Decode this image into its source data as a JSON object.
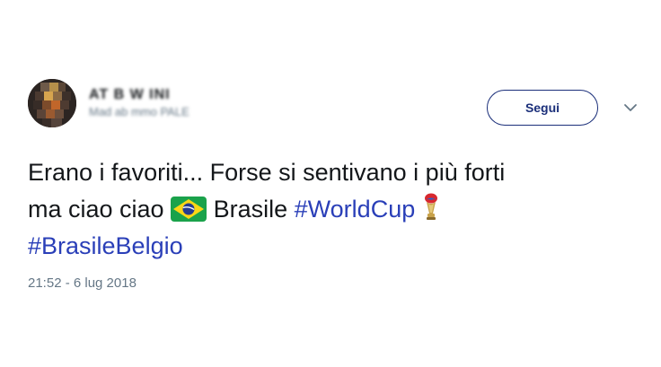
{
  "user": {
    "display_name": "AT B W INI",
    "handle": "Mad ab mmo PALE",
    "avatar_alt": "avatar"
  },
  "follow_button": {
    "label": "Segui"
  },
  "menu": {
    "icon": "chevron-down-icon"
  },
  "tweet": {
    "line1": "Erano i favoriti... Forse si sentivano i più forti",
    "line2_prefix": "ma  ciao ciao",
    "line2_country": "Brasile",
    "hashtag1": "#WorldCup",
    "hashtag2": "#BrasileBelgio",
    "emoji1": "brazil-flag-icon",
    "emoji2": "world-cup-trophy-icon"
  },
  "timestamp": "21:52 - 6 lug 2018",
  "colors": {
    "hashtag": "#2a3fb8",
    "follow_border": "#1b2f7a",
    "secondary_text": "#657786",
    "primary_text": "#14171a"
  }
}
